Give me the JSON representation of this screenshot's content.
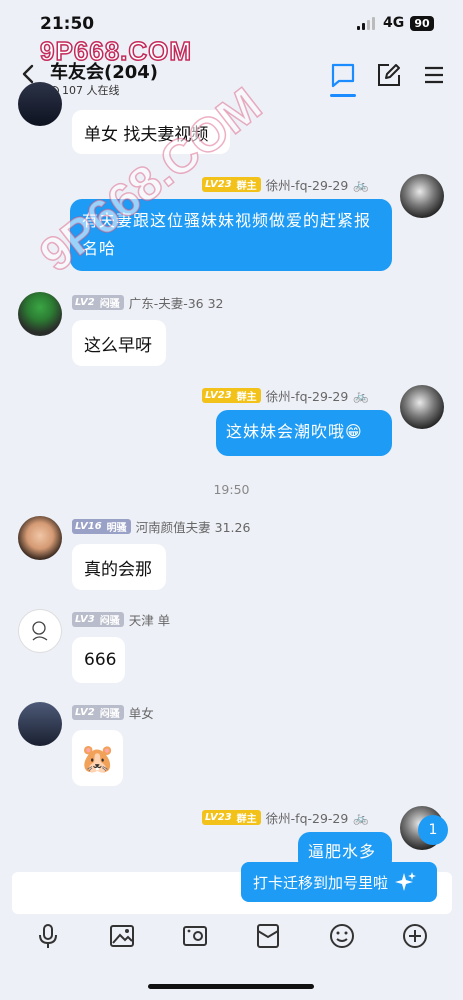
{
  "status": {
    "time": "21:50",
    "network": "4G",
    "battery": "90"
  },
  "watermark": "9P668.COM",
  "header": {
    "title": "车友会(204)",
    "online": "107 人在线"
  },
  "messages": [
    {
      "side": "in",
      "text": "单女 找夫妻视频"
    },
    {
      "side": "out",
      "level": "LV23",
      "role": "群主",
      "name": "徐州-fq-29-29",
      "text": "有夫妻跟这位骚妹妹视频做爱的赶紧报名哈"
    },
    {
      "side": "in",
      "level": "LV2",
      "role": "闷骚",
      "name": "广东-夫妻-36 32",
      "text": "这么早呀"
    },
    {
      "side": "out",
      "level": "LV23",
      "role": "群主",
      "name": "徐州-fq-29-29",
      "text": "这妹妹会潮吹哦",
      "emoji": "😁"
    },
    {
      "side": "in",
      "level": "LV16",
      "role": "明骚",
      "name": "河南颜值夫妻 31.26",
      "text": "真的会那"
    },
    {
      "side": "in",
      "level": "LV3",
      "role": "闷骚",
      "name": "天津 单",
      "text": "666"
    },
    {
      "side": "in",
      "level": "LV2",
      "role": "闷骚",
      "name": "单女",
      "emoji": "🐹"
    },
    {
      "side": "out",
      "level": "LV23",
      "role": "群主",
      "name": "徐州-fq-29-29",
      "text": "逼肥水多"
    }
  ],
  "timestamp": "19:50",
  "toast": {
    "text": "打卡迁移到加号里啦",
    "icon": "sparkle-icon"
  },
  "badge": "1",
  "colors": {
    "accent": "#1d9bf5",
    "gold": "#f3c21a"
  }
}
